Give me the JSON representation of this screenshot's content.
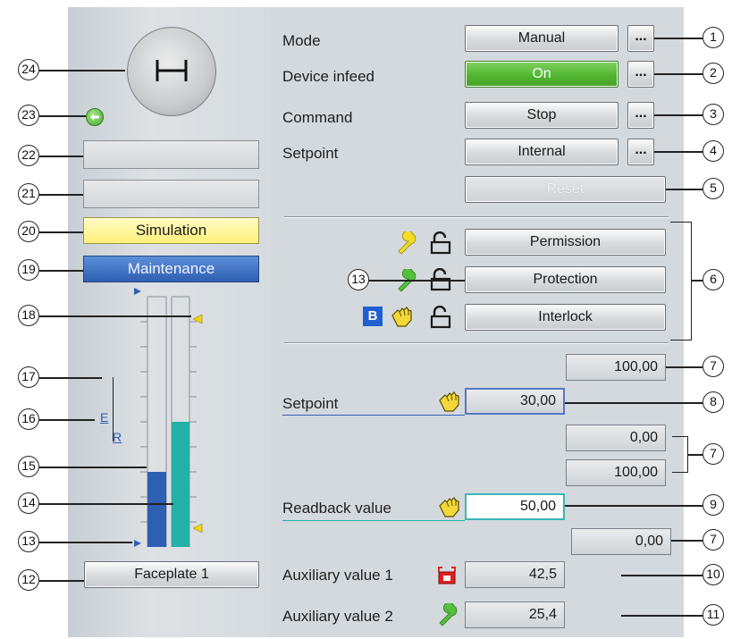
{
  "colors": {
    "panel": "#d4d9dd",
    "green_on": "#4fb32e",
    "simulation": "#fff48a",
    "maintenance": "#3c6fc1",
    "setpoint_bar": "#2f5fb3",
    "readback_bar": "#23b0a6",
    "setpoint_frame": "#5577c2",
    "readback_frame": "#3bb6b5"
  },
  "left": {
    "device_icon": "valve-stop-icon",
    "status_display_22": "",
    "status_display_21": "",
    "simulation_label": "Simulation",
    "maintenance_label": "Maintenance",
    "bar_label_E": "E",
    "bar_label_R": "R",
    "faceplate_label": "Faceplate 1",
    "setpoint_bar_level": 0.3,
    "readback_bar_level": 0.5
  },
  "rows": {
    "mode_label": "Mode",
    "mode_value": "Manual",
    "infeed_label": "Device infeed",
    "infeed_value": "On",
    "command_label": "Command",
    "command_value": "Stop",
    "setpoint_src_label": "Setpoint",
    "setpoint_src_value": "Internal",
    "dots": "...",
    "reset_label": "Reset"
  },
  "locks": {
    "permission_label": "Permission",
    "protection_label": "Protection",
    "interlock_label": "Interlock",
    "bypass_badge": "B"
  },
  "analog": {
    "sp_high_limit": "100,00",
    "setpoint_label": "Setpoint",
    "setpoint_value": "30,00",
    "rb_low_limit": "0,00",
    "rb_high_limit": "100,00",
    "readback_label": "Readback value",
    "readback_value": "50,00",
    "sp_low_limit": "0,00",
    "aux1_label": "Auxiliary value 1",
    "aux1_value": "42,5",
    "aux2_label": "Auxiliary value 2",
    "aux2_value": "25,4"
  },
  "callouts": {
    "c1": "1",
    "c2": "2",
    "c3": "3",
    "c4": "4",
    "c5": "5",
    "c6": "6",
    "c7a": "7",
    "c7b": "7",
    "c7c": "7",
    "c8": "8",
    "c9": "9",
    "c10": "10",
    "c11": "11",
    "c12": "12",
    "c13a": "13",
    "c13b": "13",
    "c14": "14",
    "c15": "15",
    "c16": "16",
    "c17": "17",
    "c18": "18",
    "c19": "19",
    "c20": "20",
    "c21": "21",
    "c22": "22",
    "c23": "23",
    "c24": "24"
  }
}
